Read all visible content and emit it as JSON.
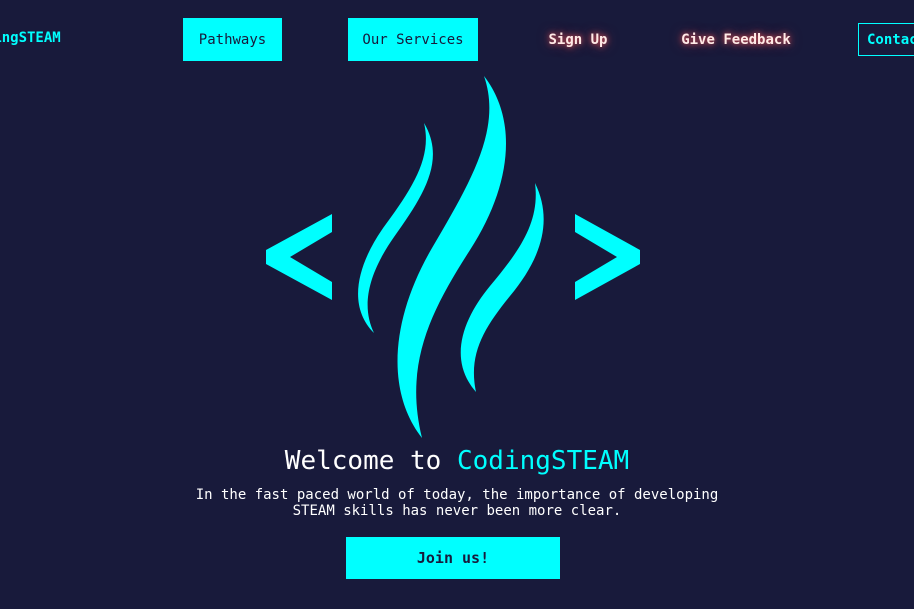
{
  "header": {
    "brand": "CodingSTEAM",
    "nav": {
      "pathways": "Pathways",
      "services": "Our Services",
      "signup": "Sign Up",
      "feedback": "Give Feedback",
      "contact": "Contact"
    }
  },
  "hero": {
    "logo_icon": "code-brackets-flame-icon",
    "title_prefix": "Welcome to",
    "title_accent": "CodingSTEAM",
    "subtitle": "In the fast paced world of today, the importance of developing STEAM skills has never been more clear.",
    "cta_label": "Join us!"
  },
  "colors": {
    "background": "#181a3b",
    "accent": "#00ffff",
    "glow": "#ff5a5a",
    "text": "#ffffff"
  }
}
